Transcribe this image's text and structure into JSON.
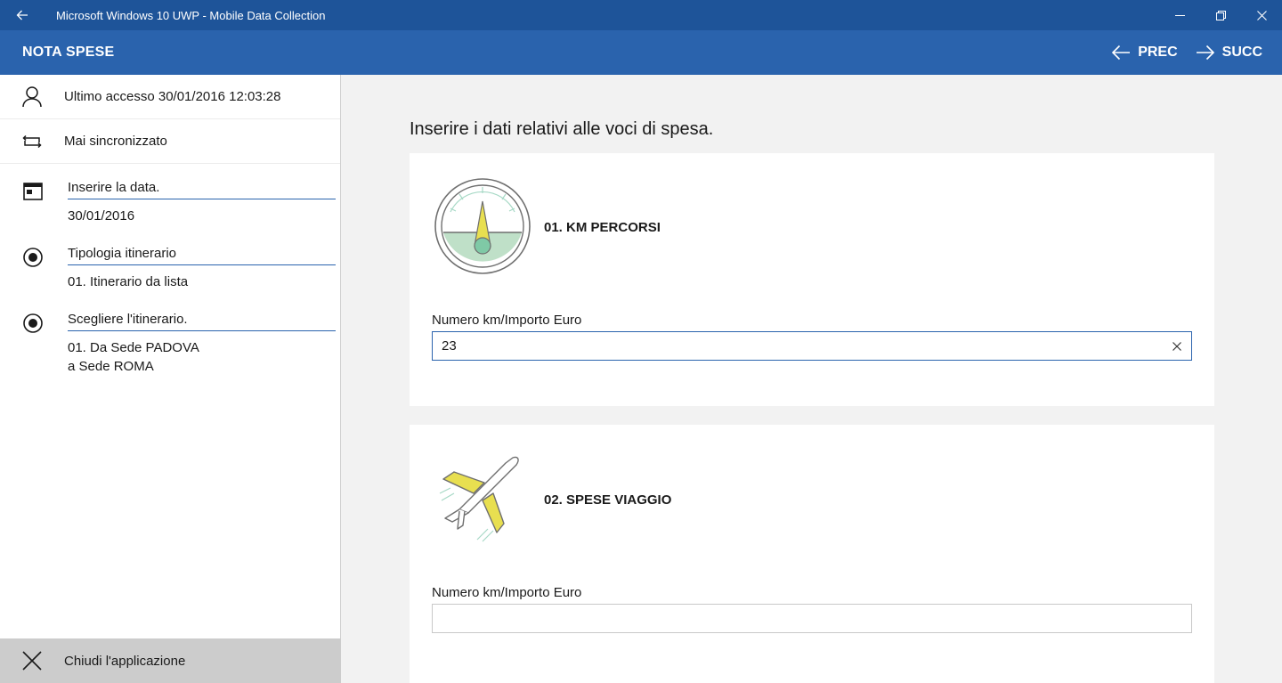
{
  "window": {
    "title": "Microsoft Windows 10 UWP - Mobile Data Collection"
  },
  "appbar": {
    "title": "NOTA SPESE",
    "prev_label": "PREC",
    "next_label": "SUCC"
  },
  "sidebar": {
    "last_access": "Ultimo accesso 30/01/2016 12:03:28",
    "sync_status": "Mai sincronizzato",
    "fields": [
      {
        "label": "Inserire la data.",
        "value_line1": "30/01/2016",
        "value_line2": ""
      },
      {
        "label": "Tipologia itinerario",
        "value_line1": "01. Itinerario da lista",
        "value_line2": ""
      },
      {
        "label": "Scegliere l'itinerario.",
        "value_line1": "01. Da Sede PADOVA",
        "value_line2": "a Sede ROMA"
      }
    ],
    "close_label": "Chiudi l'applicazione"
  },
  "main": {
    "heading": "Inserire i dati relativi alle voci di spesa.",
    "cards": [
      {
        "title": "01. KM PERCORSI",
        "input_label": "Numero km/Importo Euro",
        "input_value": "23",
        "icon": "speedometer-icon"
      },
      {
        "title": "02. SPESE VIAGGIO",
        "input_label": "Numero km/Importo Euro",
        "input_value": "",
        "icon": "airplane-icon"
      }
    ]
  },
  "colors": {
    "titlebar": "#1e5499",
    "appbar": "#2a63ad",
    "accent_yellow": "#e8df50",
    "accent_green": "#bfe0c8"
  }
}
